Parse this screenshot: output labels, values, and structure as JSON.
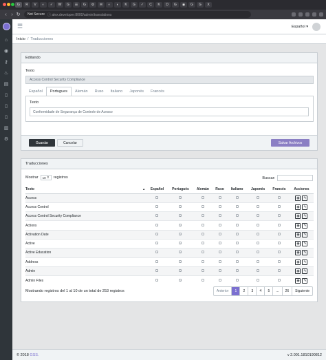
{
  "browser": {
    "security_label": "Not Secure",
    "url": "ⓘ alex.developer:8000/admin/translations",
    "tabs": [
      "G",
      "R",
      "V",
      "◐",
      "✓",
      "W",
      "G",
      "☰",
      "G",
      "⚙",
      "✉",
      "◐",
      "◐",
      "K",
      "G",
      "✓",
      "C",
      "K",
      "D",
      "G",
      "◉",
      "G",
      "G",
      "X"
    ]
  },
  "header": {
    "language": "Español ▾"
  },
  "sidebar": {
    "icons": [
      "home-icon",
      "dashboard-icon",
      "key-icon",
      "fire-icon",
      "chart-icon",
      "document-icon",
      "document-icon",
      "document-icon",
      "trash-icon",
      "cogs-icon"
    ]
  },
  "breadcrumb": {
    "home": "Inicio",
    "separator": "/",
    "current": "Traducciones"
  },
  "edit": {
    "title": "Editando",
    "text_label": "Texto",
    "text_value": "Access Control Security Compliance",
    "tabs": [
      "Español",
      "Portugues",
      "Alemán",
      "Ruso",
      "Italiano",
      "Japonés",
      "Francés"
    ],
    "active_tab": "Portugues",
    "pane_label": "Texto",
    "pane_value": "Conformidade de Segurança de Controle de Acesso",
    "save": "Guardar",
    "cancel": "Cancelar",
    "save_files": "Salvar Archivos"
  },
  "list": {
    "title": "Traducciones",
    "show_prefix": "Mostrar",
    "show_value": "10",
    "show_suffix": "registros",
    "search_label": "Buscar:",
    "columns": [
      "Texto",
      "Español",
      "Portugués",
      "Alemán",
      "Ruso",
      "Italiano",
      "Japonés",
      "Francés",
      "Acciones"
    ],
    "rows": [
      {
        "text": "Access",
        "flags": [
          true,
          true,
          false,
          false,
          false,
          false,
          false
        ]
      },
      {
        "text": "Access Control",
        "flags": [
          true,
          true,
          false,
          false,
          false,
          false,
          false
        ]
      },
      {
        "text": "Access Control Security Compliance",
        "flags": [
          true,
          true,
          false,
          false,
          false,
          false,
          false
        ]
      },
      {
        "text": "Actions",
        "flags": [
          true,
          true,
          false,
          false,
          false,
          false,
          false
        ]
      },
      {
        "text": "Activation Date",
        "flags": [
          true,
          true,
          false,
          false,
          false,
          false,
          false
        ]
      },
      {
        "text": "Active",
        "flags": [
          true,
          true,
          false,
          false,
          false,
          false,
          false
        ]
      },
      {
        "text": "Active Education",
        "flags": [
          true,
          true,
          false,
          false,
          false,
          false,
          false
        ]
      },
      {
        "text": "Address",
        "flags": [
          true,
          true,
          false,
          false,
          false,
          false,
          false
        ]
      },
      {
        "text": "Admin",
        "flags": [
          true,
          true,
          false,
          false,
          false,
          false,
          false
        ]
      },
      {
        "text": "Admin Files",
        "flags": [
          true,
          true,
          false,
          false,
          false,
          false,
          false
        ]
      }
    ],
    "info": "Mostrando registros del 1 al 10 de un total de 253 registros",
    "pager": [
      "Anterior",
      "1",
      "2",
      "3",
      "4",
      "5",
      "...",
      "26",
      "Siguiente"
    ],
    "active_page": "1"
  },
  "footer": {
    "copyright": "© 2018",
    "brand": "GSS.",
    "version": "v 2.001.1810190812"
  }
}
